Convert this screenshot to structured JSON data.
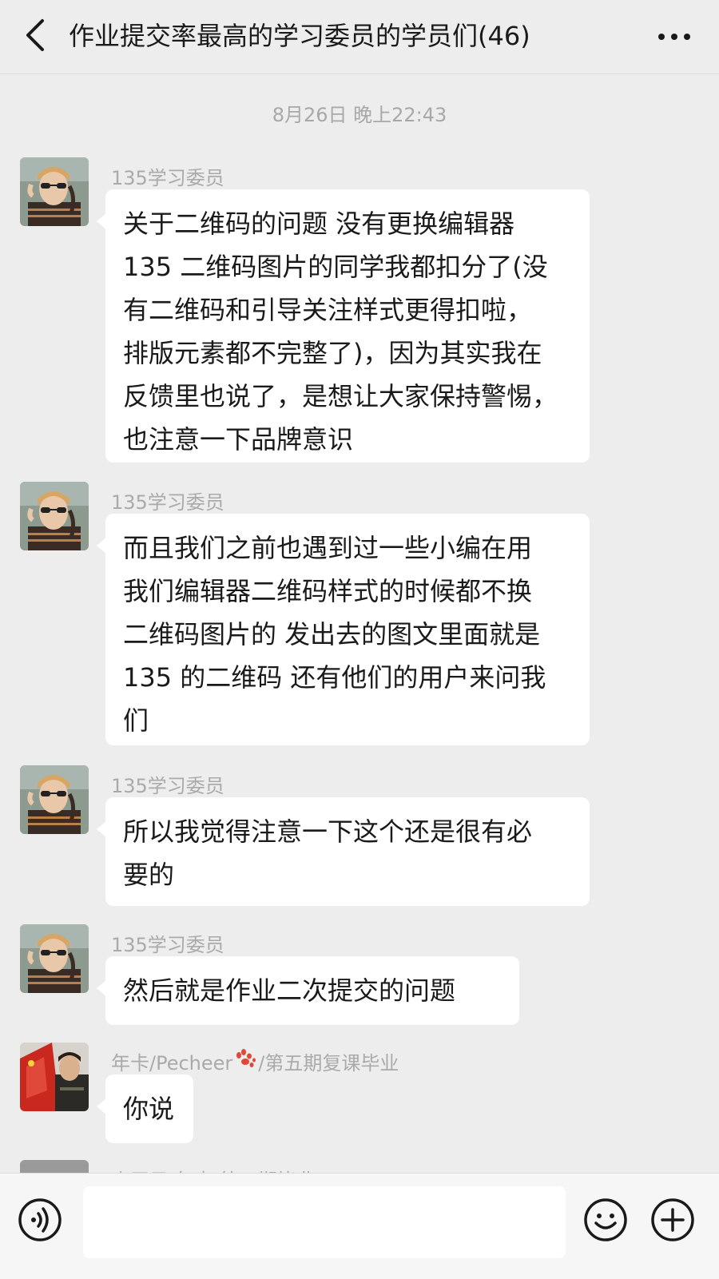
{
  "header": {
    "title": "作业提交率最高的学习委员的学员们(46)",
    "back_icon": "chevron-left-icon",
    "more_icon": "more-dots-icon"
  },
  "timestamp": "8月26日 晚上22:43",
  "messages": [
    {
      "sender": "135学习委员",
      "text": "关于二维码的问题 没有更换编辑器\n135 二维码图片的同学我都扣分了(没\n有二维码和引导关注样式更得扣啦，\n排版元素都不完整了)，因为其实我在\n反馈里也说了，是想让大家保持警惕，\n也注意一下品牌意识"
    },
    {
      "sender": "135学习委员",
      "text": "而且我们之前也遇到过一些小编在用\n我们编辑器二维码样式的时候都不换\n二维码图片的 发出去的图文里面就是\n135 的二维码 还有他们的用户来问我\n们"
    },
    {
      "sender": "135学习委员",
      "text": "所以我觉得注意一下这个还是很有必\n要的"
    },
    {
      "sender": "135学习委员",
      "text": "然后就是作业二次提交的问题"
    },
    {
      "sender_prefix": "年卡/Pecheer",
      "sender_suffix": "/第五期复课毕业",
      "text": "你说"
    }
  ],
  "partial_sender": "小王子/年卡/第五期毕业",
  "input": {
    "value": "",
    "placeholder": ""
  },
  "colors": {
    "background": "#ededed",
    "bubble": "#ffffff",
    "sender_text": "#aaaaaa",
    "paw": "#e0483a"
  }
}
